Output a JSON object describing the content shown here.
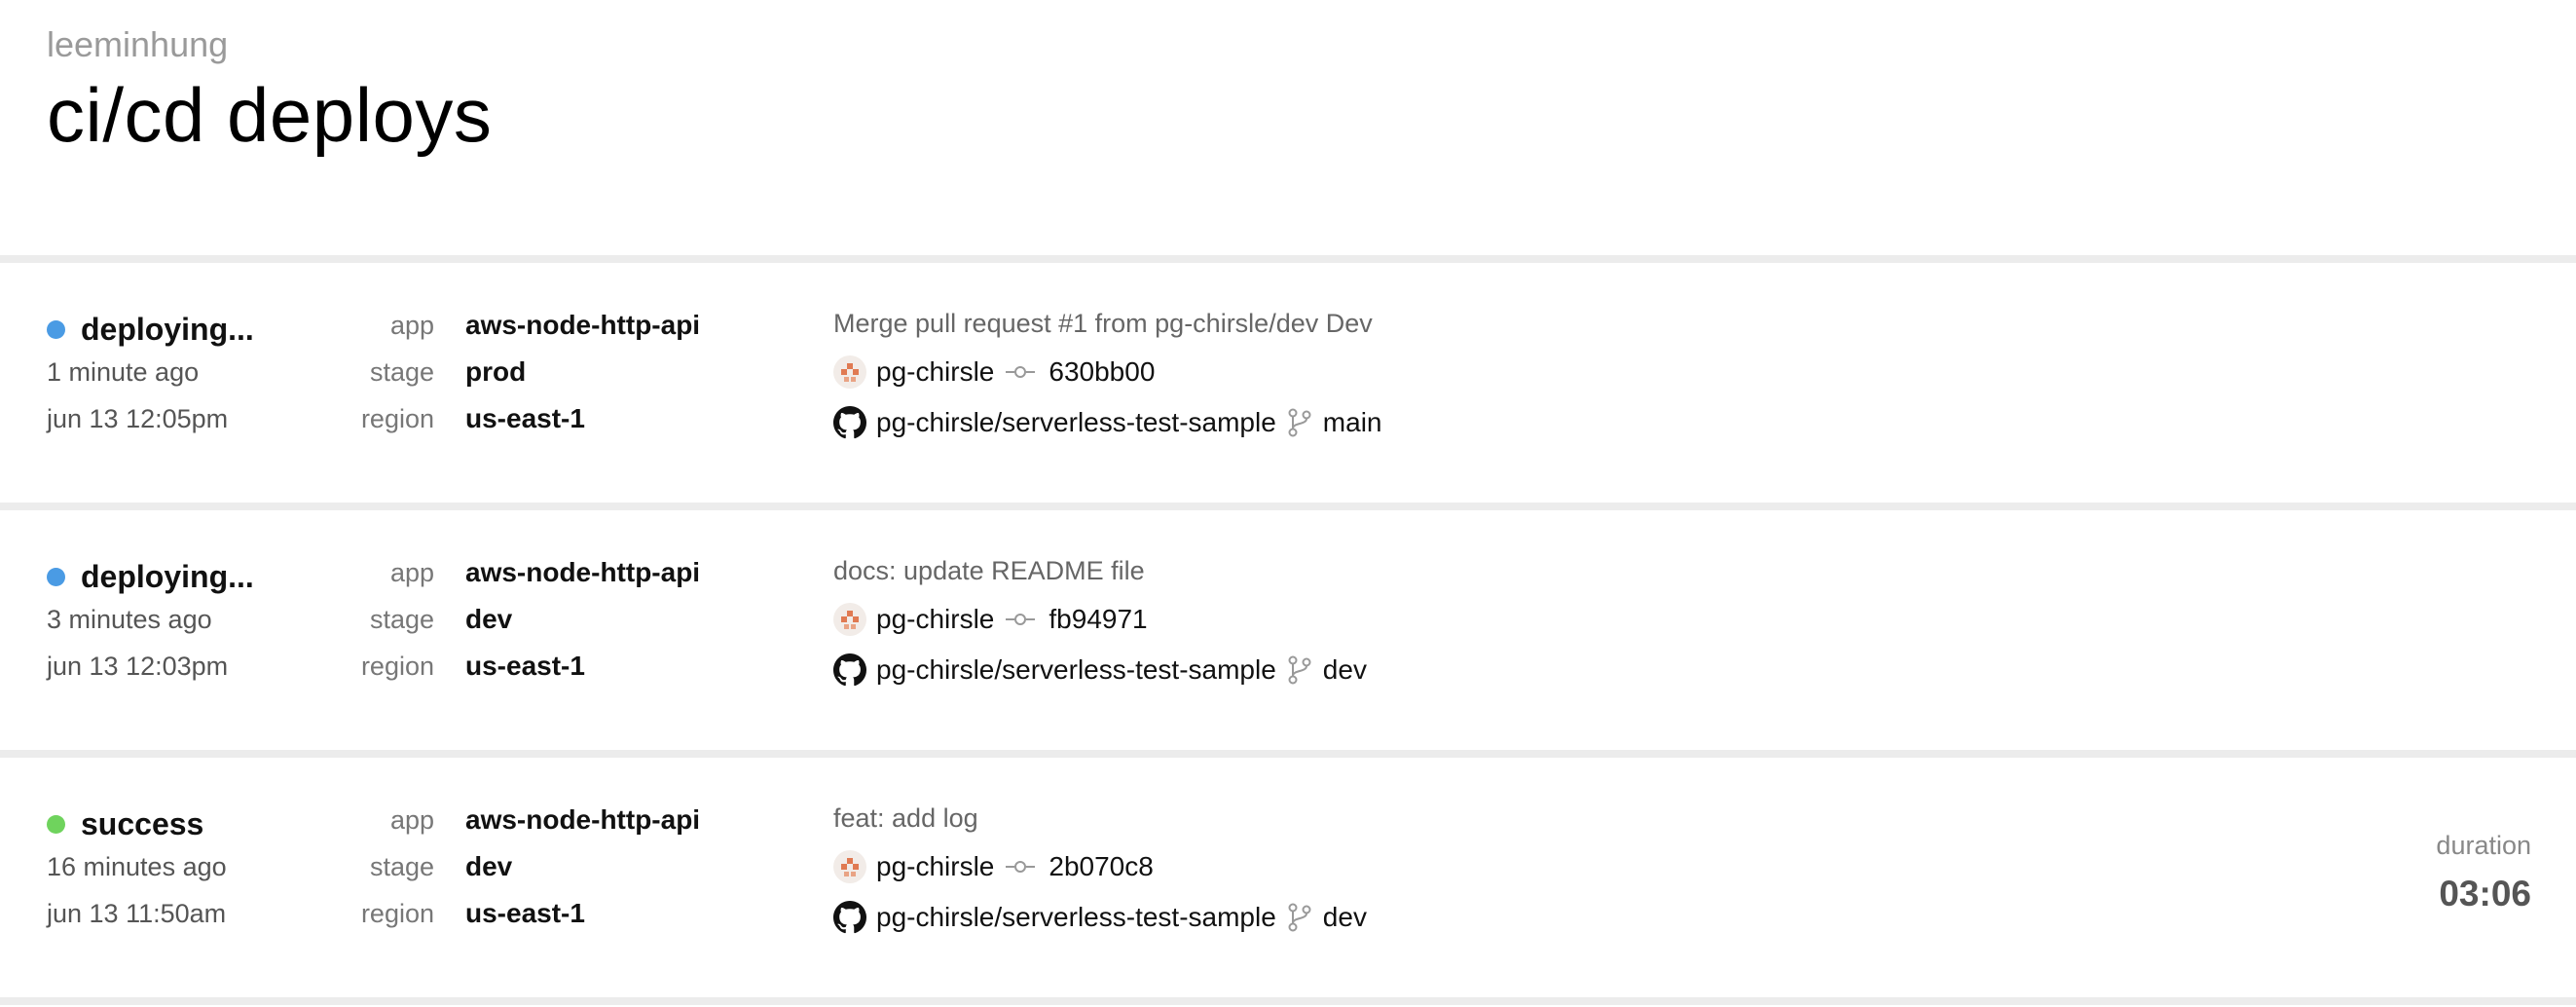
{
  "header": {
    "org": "leeminhung",
    "title": "ci/cd deploys"
  },
  "labels": {
    "app": "app",
    "stage": "stage",
    "region": "region",
    "duration": "duration"
  },
  "colors": {
    "deploying": "#4a9be4",
    "success": "#6fd35d",
    "separator": "#ececec"
  },
  "deploys": [
    {
      "status": "deploying...",
      "status_color": "#4a9be4",
      "ago": "1 minute ago",
      "when": "jun 13 12:05pm",
      "app": "aws-node-http-api",
      "stage": "prod",
      "region": "us-east-1",
      "commit_message": "Merge pull request #1 from pg-chirsle/dev Dev",
      "author": "pg-chirsle",
      "commit": "630bb00",
      "repo": "pg-chirsle/serverless-test-sample",
      "branch": "main",
      "duration": ""
    },
    {
      "status": "deploying...",
      "status_color": "#4a9be4",
      "ago": "3 minutes ago",
      "when": "jun 13 12:03pm",
      "app": "aws-node-http-api",
      "stage": "dev",
      "region": "us-east-1",
      "commit_message": "docs: update README file",
      "author": "pg-chirsle",
      "commit": "fb94971",
      "repo": "pg-chirsle/serverless-test-sample",
      "branch": "dev",
      "duration": ""
    },
    {
      "status": "success",
      "status_color": "#6fd35d",
      "ago": "16 minutes ago",
      "when": "jun 13 11:50am",
      "app": "aws-node-http-api",
      "stage": "dev",
      "region": "us-east-1",
      "commit_message": "feat: add log",
      "author": "pg-chirsle",
      "commit": "2b070c8",
      "repo": "pg-chirsle/serverless-test-sample",
      "branch": "dev",
      "duration": "03:06"
    }
  ],
  "icons": {
    "status": "status-dot-icon",
    "avatar": "avatar-icon",
    "commit": "git-commit-icon",
    "repo": "github-icon",
    "branch": "git-branch-icon"
  }
}
